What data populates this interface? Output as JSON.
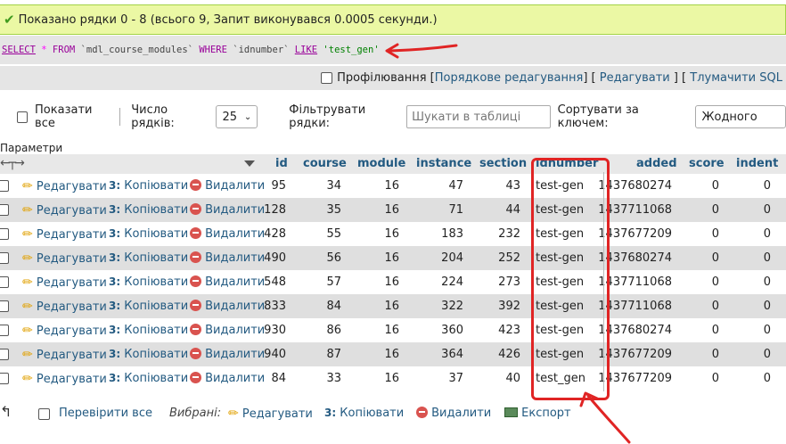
{
  "success_message": "Показано рядки 0 - 8 (всього 9, Запит виконувався 0.0005 секунди.)",
  "sql": {
    "select": "SELECT",
    "star": "*",
    "from": "FROM",
    "table": "`mdl_course_modules`",
    "where": "WHERE",
    "column": "`idnumber`",
    "like": "LIKE",
    "value": "'test_gen'"
  },
  "profiling": {
    "checkbox_label": "Профілювання",
    "links": [
      "Порядкове редагування",
      "Редагувати",
      "Тлумачити SQL"
    ]
  },
  "controls": {
    "show_all_label": "Показати все",
    "rows_label": "Число рядків:",
    "rows_value": "25",
    "filter_label": "Фільтрувати рядки:",
    "filter_placeholder": "Шукати в таблиці",
    "sort_label": "Сортувати за ключем:",
    "sort_value": "Жодного"
  },
  "table": {
    "params_title": "Параметри",
    "columns": [
      "id",
      "course",
      "module",
      "instance",
      "section",
      "idnumber",
      "added",
      "score",
      "indent"
    ],
    "action_labels": {
      "edit": "Редагувати",
      "copy": "Копіювати",
      "delete": "Видалити"
    },
    "rows": [
      {
        "id": "95",
        "course": "34",
        "module": "16",
        "instance": "47",
        "section": "43",
        "idnumber": "test-gen",
        "added": "1437680274",
        "score": "0",
        "indent": "0"
      },
      {
        "id": "128",
        "course": "35",
        "module": "16",
        "instance": "71",
        "section": "44",
        "idnumber": "test-gen",
        "added": "1437711068",
        "score": "0",
        "indent": "0"
      },
      {
        "id": "428",
        "course": "55",
        "module": "16",
        "instance": "183",
        "section": "232",
        "idnumber": "test-gen",
        "added": "1437677209",
        "score": "0",
        "indent": "0"
      },
      {
        "id": "490",
        "course": "56",
        "module": "16",
        "instance": "204",
        "section": "252",
        "idnumber": "test-gen",
        "added": "1437680274",
        "score": "0",
        "indent": "0"
      },
      {
        "id": "548",
        "course": "57",
        "module": "16",
        "instance": "224",
        "section": "273",
        "idnumber": "test-gen",
        "added": "1437711068",
        "score": "0",
        "indent": "0"
      },
      {
        "id": "833",
        "course": "84",
        "module": "16",
        "instance": "322",
        "section": "392",
        "idnumber": "test-gen",
        "added": "1437711068",
        "score": "0",
        "indent": "0"
      },
      {
        "id": "930",
        "course": "86",
        "module": "16",
        "instance": "360",
        "section": "423",
        "idnumber": "test-gen",
        "added": "1437680274",
        "score": "0",
        "indent": "0"
      },
      {
        "id": "940",
        "course": "87",
        "module": "16",
        "instance": "364",
        "section": "426",
        "idnumber": "test-gen",
        "added": "1437677209",
        "score": "0",
        "indent": "0"
      },
      {
        "id": "84",
        "course": "33",
        "module": "16",
        "instance": "37",
        "section": "40",
        "idnumber": "test_gen",
        "added": "1437677209",
        "score": "0",
        "indent": "0"
      }
    ]
  },
  "footer": {
    "check_all_label": "Перевірити все",
    "selected_label": "Вибрані:",
    "edit_label": "Редагувати",
    "copy_label": "Копіювати",
    "delete_label": "Видалити",
    "export_label": "Експорт"
  },
  "colors": {
    "success_bg": "#ebf8a4",
    "link": "#235a81",
    "annotation_red": "#e02424",
    "row_alt": "#dfdfdf"
  },
  "icons": [
    "check-icon",
    "pencil-icon",
    "copy-icon",
    "delete-icon",
    "export-icon",
    "sort-arrow-icon",
    "chevron-down-icon"
  ]
}
